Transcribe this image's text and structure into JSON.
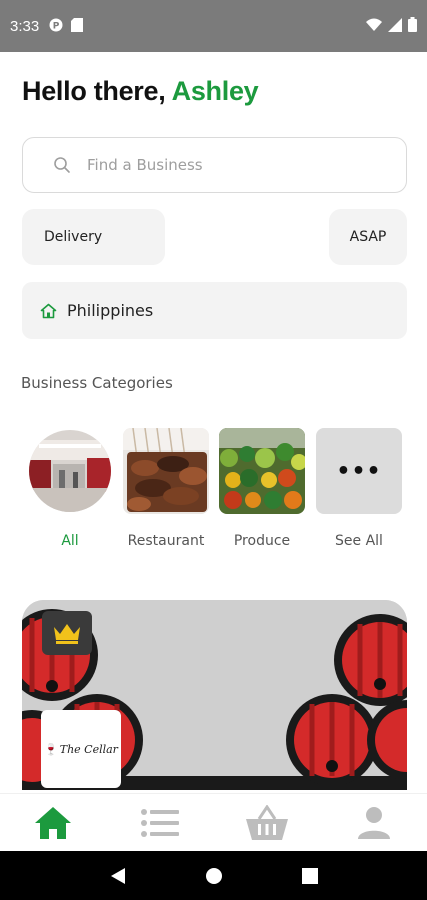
{
  "status_bar": {
    "time": "3:33"
  },
  "greeting": {
    "prefix": "Hello there,",
    "name": "Ashley"
  },
  "search": {
    "placeholder": "Find a Business",
    "icon": "search-icon"
  },
  "filters": {
    "delivery_label": "Delivery",
    "time_label": "ASAP"
  },
  "location": {
    "label": "Philippines",
    "icon": "home-icon"
  },
  "categories": {
    "title": "Business Categories",
    "items": [
      {
        "label": "All"
      },
      {
        "label": "Restaurant"
      },
      {
        "label": "Produce"
      },
      {
        "label": "See All",
        "glyph": "•••"
      }
    ]
  },
  "featured": {
    "badge_icon": "crown-icon",
    "logo_text": "The Cellar"
  },
  "bottom_nav": {
    "items": [
      {
        "name": "home",
        "icon": "home-icon",
        "active": true
      },
      {
        "name": "list",
        "icon": "list-icon"
      },
      {
        "name": "basket",
        "icon": "basket-icon"
      },
      {
        "name": "profile",
        "icon": "person-icon"
      }
    ]
  },
  "colors": {
    "accent": "#1c9a3e",
    "status_bar": "#7b7b7b",
    "pill_bg": "#f3f3f3",
    "barrel_red": "#d42a2a"
  }
}
